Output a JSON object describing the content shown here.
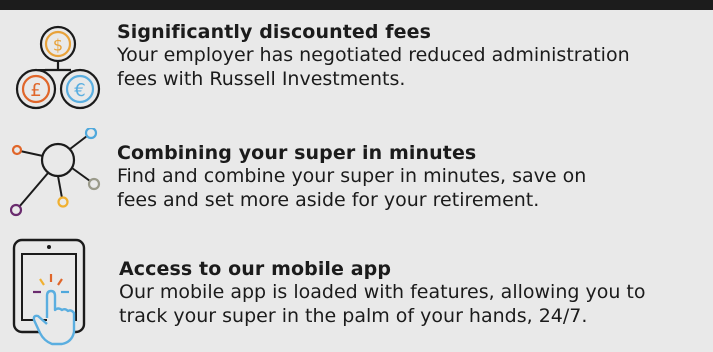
{
  "features": [
    {
      "icon": "currency-coins-icon",
      "title": "Significantly discounted fees",
      "line1": "Your employer has negotiated reduced administration",
      "line2": "fees with Russell Investments."
    },
    {
      "icon": "network-nodes-icon",
      "title": "Combining your super in minutes",
      "line1": "Find and combine your super in minutes, save on",
      "line2": "fees and set more aside for your retirement."
    },
    {
      "icon": "tablet-touch-icon",
      "title": "Access to our mobile app",
      "line1": "Our mobile app is loaded with features, allowing you to",
      "line2": "track your super in the palm of your hands, 24/7."
    }
  ],
  "colors": {
    "background": "#e9e9e9",
    "top_bar": "#1c1c1c",
    "icon_outline": "#1b1b1b",
    "coin_orange": "#e8a23a",
    "coin_blue": "#5aaee0",
    "node_orange": "#e0662a",
    "node_purple": "#6a2b6e",
    "node_gold": "#f0b030",
    "node_grey": "#9a9a8a",
    "node_blue": "#4fa8dc",
    "hand_blue": "#5aaee0"
  }
}
